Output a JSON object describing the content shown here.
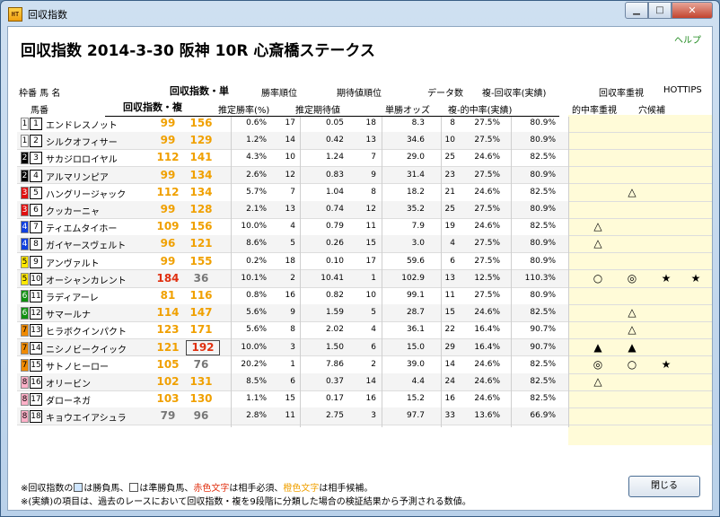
{
  "window": {
    "icon_label": "HT",
    "title": "回収指数",
    "min_glyph": "▁",
    "max_glyph": "□",
    "close_glyph": "✕"
  },
  "header": {
    "title": "回収指数  2014-3-30 阪神 10R 心斎橋ステークス",
    "help": "ヘルプ"
  },
  "columns": {
    "waku_uma": "枠番   馬 名",
    "umaban": "馬番",
    "ai_tan": "回収指数・単",
    "ai_fuku": "回収指数・複",
    "suitei_shoritsu": "推定勝率(%)",
    "shoritsu_jun": "勝率順位",
    "suitei_kitaichi": "推定期待値",
    "kitaichi_jun": "期待値順位",
    "tansho_odds": "単勝オッズ",
    "data_su": "データ数",
    "fuku_tekichu": "複-的中率(実績)",
    "fuku_kaishu": "複-回収率(実績)",
    "tekichu_juushi": "的中率重視",
    "kaishu_juushi": "回収率重視",
    "ana_kouho": "穴候補",
    "hottips": "HOTTIPS"
  },
  "colors": {
    "orange": "#f0a000",
    "red": "#e03010",
    "gray": "#777777"
  },
  "rows": [
    {
      "waku": "1",
      "uma": "1",
      "name": "エンドレスノット",
      "tan": "99",
      "fuku": "156",
      "tan_c": "orange",
      "fuku_c": "orange",
      "p": "0.6%",
      "pr": "17",
      "e": "0.05",
      "er": "18",
      "o": "8.3",
      "d": "8",
      "hit": "27.5%",
      "rec": "80.9%",
      "m": [
        "",
        "",
        "",
        ""
      ]
    },
    {
      "waku": "1",
      "uma": "2",
      "name": "シルクオフィサー",
      "tan": "99",
      "fuku": "129",
      "tan_c": "orange",
      "fuku_c": "orange",
      "p": "1.2%",
      "pr": "14",
      "e": "0.42",
      "er": "13",
      "o": "34.6",
      "d": "10",
      "hit": "27.5%",
      "rec": "80.9%",
      "m": [
        "",
        "",
        "",
        ""
      ]
    },
    {
      "waku": "2",
      "uma": "3",
      "name": "サカジロロイヤル",
      "tan": "112",
      "fuku": "141",
      "tan_c": "orange",
      "fuku_c": "orange",
      "p": "4.3%",
      "pr": "10",
      "e": "1.24",
      "er": "7",
      "o": "29.0",
      "d": "25",
      "hit": "24.6%",
      "rec": "82.5%",
      "m": [
        "",
        "",
        "",
        ""
      ]
    },
    {
      "waku": "2",
      "uma": "4",
      "name": "アルマリンピア",
      "tan": "99",
      "fuku": "134",
      "tan_c": "orange",
      "fuku_c": "orange",
      "p": "2.6%",
      "pr": "12",
      "e": "0.83",
      "er": "9",
      "o": "31.4",
      "d": "23",
      "hit": "27.5%",
      "rec": "80.9%",
      "m": [
        "",
        "",
        "",
        ""
      ]
    },
    {
      "waku": "3",
      "uma": "5",
      "name": "ハングリージャック",
      "tan": "112",
      "fuku": "134",
      "tan_c": "orange",
      "fuku_c": "orange",
      "p": "5.7%",
      "pr": "7",
      "e": "1.04",
      "er": "8",
      "o": "18.2",
      "d": "21",
      "hit": "24.6%",
      "rec": "82.5%",
      "m": [
        "",
        "△",
        "",
        ""
      ]
    },
    {
      "waku": "3",
      "uma": "6",
      "name": "クッカーニャ",
      "tan": "99",
      "fuku": "128",
      "tan_c": "orange",
      "fuku_c": "orange",
      "p": "2.1%",
      "pr": "13",
      "e": "0.74",
      "er": "12",
      "o": "35.2",
      "d": "25",
      "hit": "27.5%",
      "rec": "80.9%",
      "m": [
        "",
        "",
        "",
        ""
      ]
    },
    {
      "waku": "4",
      "uma": "7",
      "name": "ティエムタイホー",
      "tan": "109",
      "fuku": "156",
      "tan_c": "orange",
      "fuku_c": "orange",
      "p": "10.0%",
      "pr": "4",
      "e": "0.79",
      "er": "11",
      "o": "7.9",
      "d": "19",
      "hit": "24.6%",
      "rec": "82.5%",
      "m": [
        "△",
        "",
        "",
        ""
      ]
    },
    {
      "waku": "4",
      "uma": "8",
      "name": "ガイヤースヴェルト",
      "tan": "96",
      "fuku": "121",
      "tan_c": "orange",
      "fuku_c": "orange",
      "p": "8.6%",
      "pr": "5",
      "e": "0.26",
      "er": "15",
      "o": "3.0",
      "d": "4",
      "hit": "27.5%",
      "rec": "80.9%",
      "m": [
        "△",
        "",
        "",
        ""
      ]
    },
    {
      "waku": "5",
      "uma": "9",
      "name": "アンヴァルト",
      "tan": "99",
      "fuku": "155",
      "tan_c": "orange",
      "fuku_c": "orange",
      "p": "0.2%",
      "pr": "18",
      "e": "0.10",
      "er": "17",
      "o": "59.6",
      "d": "6",
      "hit": "27.5%",
      "rec": "80.9%",
      "m": [
        "",
        "",
        "",
        ""
      ]
    },
    {
      "waku": "5",
      "uma": "10",
      "name": "オーシャンカレント",
      "tan": "184",
      "fuku": "36",
      "tan_c": "red",
      "fuku_c": "gray",
      "p": "10.1%",
      "pr": "2",
      "e": "10.41",
      "er": "1",
      "o": "102.9",
      "d": "13",
      "hit": "12.5%",
      "rec": "110.3%",
      "m": [
        "○",
        "◎",
        "★",
        "★"
      ]
    },
    {
      "waku": "6",
      "uma": "11",
      "name": "ラディアーレ",
      "tan": "81",
      "fuku": "116",
      "tan_c": "orange",
      "fuku_c": "orange",
      "p": "0.8%",
      "pr": "16",
      "e": "0.82",
      "er": "10",
      "o": "99.1",
      "d": "11",
      "hit": "27.5%",
      "rec": "80.9%",
      "m": [
        "",
        "",
        "",
        ""
      ]
    },
    {
      "waku": "6",
      "uma": "12",
      "name": "サマールナ",
      "tan": "114",
      "fuku": "147",
      "tan_c": "orange",
      "fuku_c": "orange",
      "p": "5.6%",
      "pr": "9",
      "e": "1.59",
      "er": "5",
      "o": "28.7",
      "d": "15",
      "hit": "24.6%",
      "rec": "82.5%",
      "m": [
        "",
        "△",
        "",
        ""
      ]
    },
    {
      "waku": "7",
      "uma": "13",
      "name": "ヒラボクインパクト",
      "tan": "123",
      "fuku": "171",
      "tan_c": "orange",
      "fuku_c": "orange",
      "p": "5.6%",
      "pr": "8",
      "e": "2.02",
      "er": "4",
      "o": "36.1",
      "d": "22",
      "hit": "16.4%",
      "rec": "90.7%",
      "m": [
        "",
        "△",
        "",
        ""
      ]
    },
    {
      "waku": "7",
      "uma": "14",
      "name": "ニシノビークイック",
      "tan": "121",
      "fuku": "192",
      "tan_c": "orange",
      "fuku_c": "red",
      "fuku_box": true,
      "p": "10.0%",
      "pr": "3",
      "e": "1.50",
      "er": "6",
      "o": "15.0",
      "d": "29",
      "hit": "16.4%",
      "rec": "90.7%",
      "m": [
        "▲",
        "▲",
        "",
        ""
      ]
    },
    {
      "waku": "7",
      "uma": "15",
      "name": "サトノヒーロー",
      "tan": "105",
      "fuku": "76",
      "tan_c": "orange",
      "fuku_c": "gray",
      "p": "20.2%",
      "pr": "1",
      "e": "7.86",
      "er": "2",
      "o": "39.0",
      "d": "14",
      "hit": "24.6%",
      "rec": "82.5%",
      "m": [
        "◎",
        "○",
        "★",
        ""
      ]
    },
    {
      "waku": "8",
      "uma": "16",
      "name": "オリービン",
      "tan": "102",
      "fuku": "131",
      "tan_c": "orange",
      "fuku_c": "orange",
      "p": "8.5%",
      "pr": "6",
      "e": "0.37",
      "er": "14",
      "o": "4.4",
      "d": "24",
      "hit": "24.6%",
      "rec": "82.5%",
      "m": [
        "△",
        "",
        "",
        ""
      ]
    },
    {
      "waku": "8",
      "uma": "17",
      "name": "ダローネガ",
      "tan": "103",
      "fuku": "130",
      "tan_c": "orange",
      "fuku_c": "orange",
      "p": "1.1%",
      "pr": "15",
      "e": "0.17",
      "er": "16",
      "o": "15.2",
      "d": "16",
      "hit": "24.6%",
      "rec": "82.5%",
      "m": [
        "",
        "",
        "",
        ""
      ]
    },
    {
      "waku": "8",
      "uma": "18",
      "name": "キョウエイアシュラ",
      "tan": "79",
      "fuku": "96",
      "tan_c": "gray",
      "fuku_c": "gray",
      "p": "2.8%",
      "pr": "11",
      "e": "2.75",
      "er": "3",
      "o": "97.7",
      "d": "33",
      "hit": "13.6%",
      "rec": "66.9%",
      "m": [
        "",
        "",
        "",
        ""
      ]
    }
  ],
  "footer": {
    "line1_a": "※回収指数の",
    "line1_b": "は勝負馬、",
    "line1_c": "は準勝負馬、",
    "line1_red": "赤色文字",
    "line1_d": "は相手必須、",
    "line1_orange": "橙色文字",
    "line1_e": "は相手候補。",
    "line2": "※(実績)の項目は、過去のレースにおいて回収指数・複を9段階に分類した場合の検証結果から予測される数値。"
  },
  "close_button": "閉じる"
}
